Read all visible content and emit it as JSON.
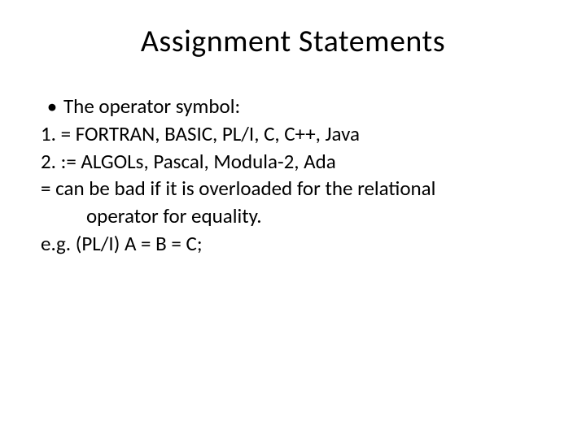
{
  "title": "Assignment Statements",
  "lines": {
    "l0_bullet": "•",
    "l0_text": "The operator symbol:",
    "l1": "1.   =    FORTRAN, BASIC, PL/I, C, C++, Java",
    "l2": "2.   :=  ALGOLs, Pascal, Modula-2, Ada",
    "l3": "=  can be bad if it is overloaded for the relational",
    "l4": "operator for equality.",
    "l5": " e.g. (PL/I)  A = B = C;"
  }
}
